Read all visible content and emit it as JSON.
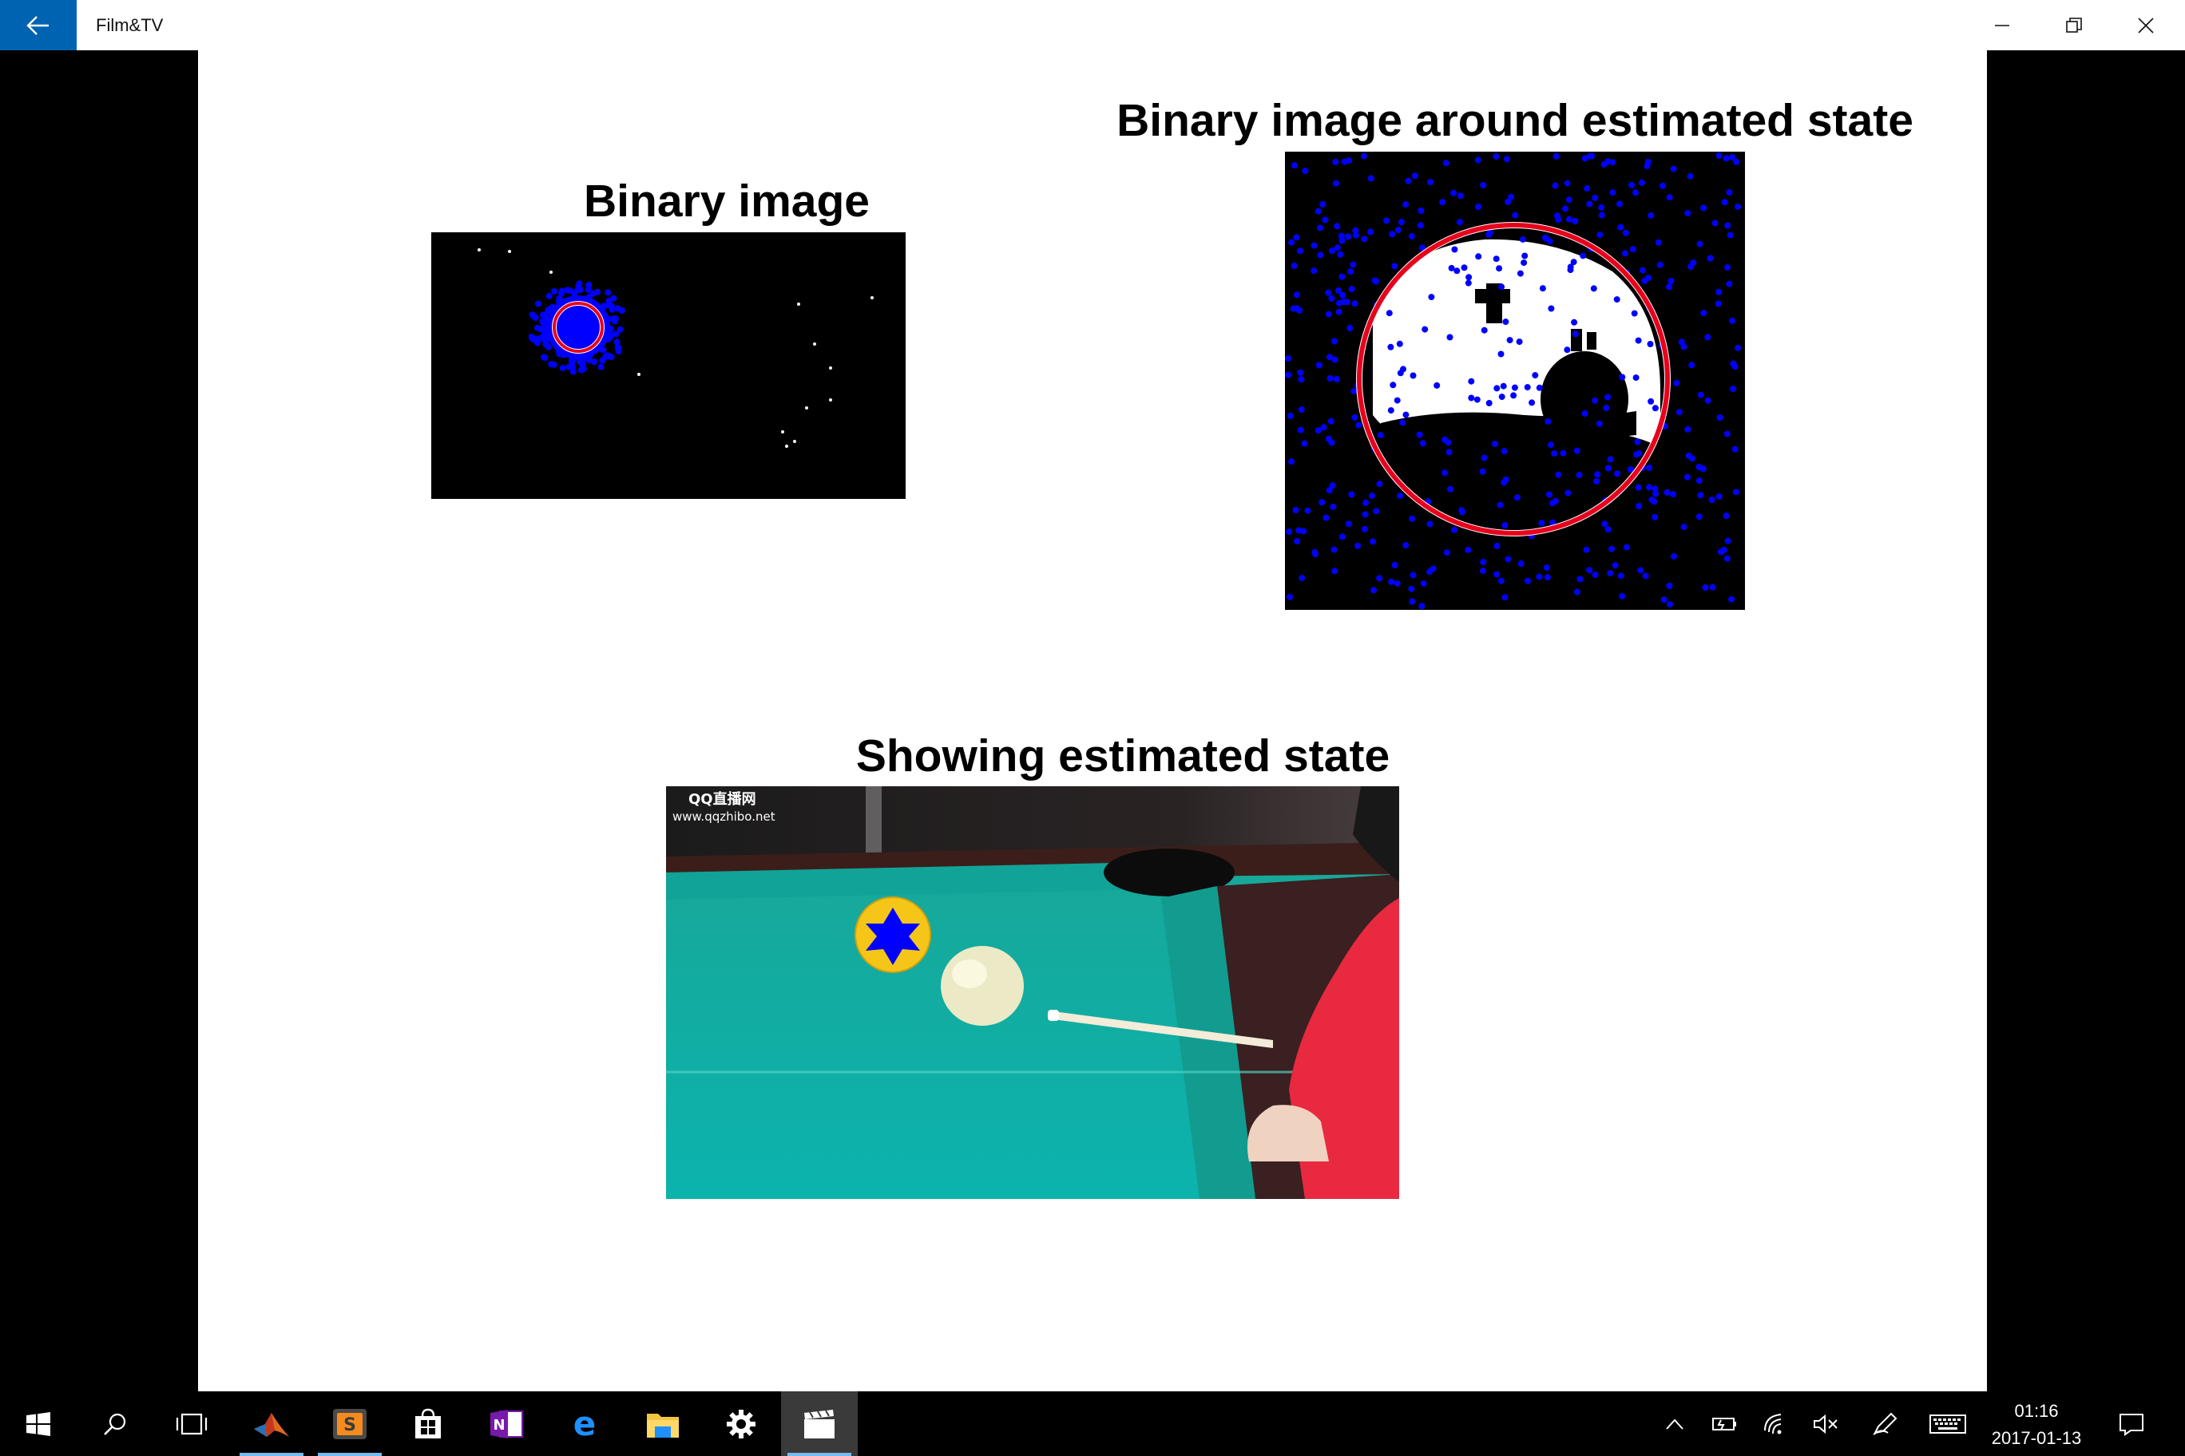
{
  "window": {
    "title": "Film&TV"
  },
  "titlebar": {
    "back_icon": "back-arrow-icon",
    "controls": [
      "minimize-icon",
      "restore-icon",
      "close-icon"
    ]
  },
  "slide": {
    "panels": [
      {
        "title": "Binary image"
      },
      {
        "title": "Binary image around estimated state"
      },
      {
        "title": "Showing estimated state",
        "watermark_line1": "QQ直播网",
        "watermark_line2": "www.qqzhibo.net"
      }
    ]
  },
  "colors": {
    "accent": "#0063b1",
    "tracking_dot": "#0000ff",
    "estimate_circle": "#e8001c",
    "pool_table": "#0fb0a6",
    "ball_yellow": "#f5c518"
  },
  "taskbar": {
    "apps": [
      "windows-start-icon",
      "search-icon",
      "task-view-icon",
      "matlab-icon",
      "sublime-text-icon",
      "store-icon",
      "onenote-icon",
      "edge-icon",
      "file-explorer-icon",
      "settings-icon",
      "film-tv-icon"
    ],
    "tray": [
      "chevron-up-icon",
      "battery-icon",
      "wifi-icon",
      "volume-muted-icon",
      "pen-icon",
      "keyboard-icon",
      "notification-icon"
    ],
    "time": "01:16",
    "date": "2017-01-13"
  }
}
